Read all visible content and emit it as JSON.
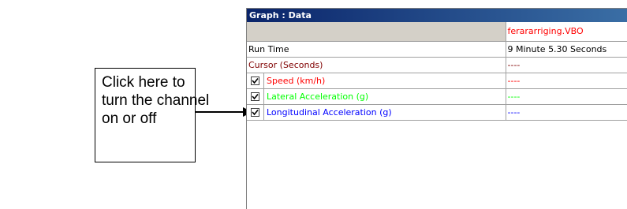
{
  "callout": {
    "lines": [
      "Click here to",
      "turn the channel",
      "on or off"
    ]
  },
  "window": {
    "title": "Graph : Data"
  },
  "table": {
    "header": {
      "file": "ferararriging.VBO"
    },
    "rows": [
      {
        "label": "Run Time",
        "value": "9 Minute 5.30 Seconds",
        "color": "#000000",
        "checkbox": false
      },
      {
        "label": "Cursor (Seconds)",
        "value": "----",
        "color": "#800000",
        "checkbox": false
      },
      {
        "label": "Speed (km/h)",
        "value": "----",
        "color": "#ff0000",
        "checkbox": true,
        "checked": true
      },
      {
        "label": "Lateral Acceleration (g)",
        "value": "----",
        "color": "#00ff00",
        "checkbox": true,
        "checked": true
      },
      {
        "label": "Longitudinal Acceleration (g)",
        "value": "----",
        "color": "#0000ff",
        "checkbox": true,
        "checked": true
      }
    ]
  },
  "colors": {
    "file_header": "#ff0000"
  }
}
